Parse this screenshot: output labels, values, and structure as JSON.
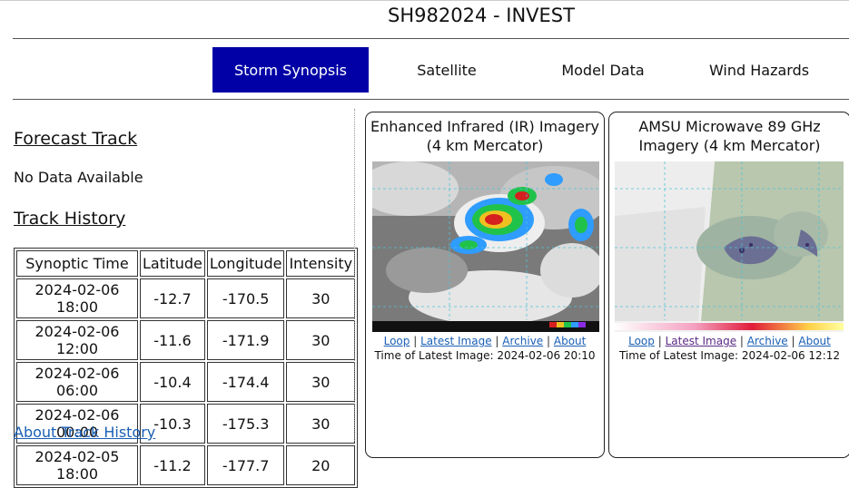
{
  "page": {
    "title": "SH982024 - INVEST"
  },
  "nav": [
    {
      "label": "Storm Synopsis",
      "active": true
    },
    {
      "label": "Satellite"
    },
    {
      "label": "Model Data"
    },
    {
      "label": "Wind Hazards"
    }
  ],
  "forecast": {
    "heading": "Forecast Track",
    "status": "No Data Available"
  },
  "history": {
    "heading": "Track History",
    "columns": [
      "Synoptic Time",
      "Latitude",
      "Longitude",
      "Intensity"
    ],
    "rows": [
      [
        "2024-02-06 18:00",
        "-12.7",
        "-170.5",
        "30"
      ],
      [
        "2024-02-06 12:00",
        "-11.6",
        "-171.9",
        "30"
      ],
      [
        "2024-02-06 06:00",
        "-10.4",
        "-174.4",
        "30"
      ],
      [
        "2024-02-06 00:00",
        "-10.3",
        "-175.3",
        "30"
      ],
      [
        "2024-02-05 18:00",
        "-11.2",
        "-177.7",
        "20"
      ]
    ],
    "about_link": "About Track History"
  },
  "panels": [
    {
      "title": "Enhanced Infrared (IR) Imagery (4 km Mercator)",
      "links": [
        "Loop",
        "Latest Image",
        "Archive",
        "About"
      ],
      "separator": "|",
      "time": "Time of Latest Image: 2024-02-06 20:10"
    },
    {
      "title": "AMSU Microwave 89 GHz Imagery (4 km Mercator)",
      "links": [
        "Loop",
        "Latest Image",
        "Archive",
        "About"
      ],
      "separator": "|",
      "time": "Time of Latest Image: 2024-02-06 12:12"
    }
  ]
}
